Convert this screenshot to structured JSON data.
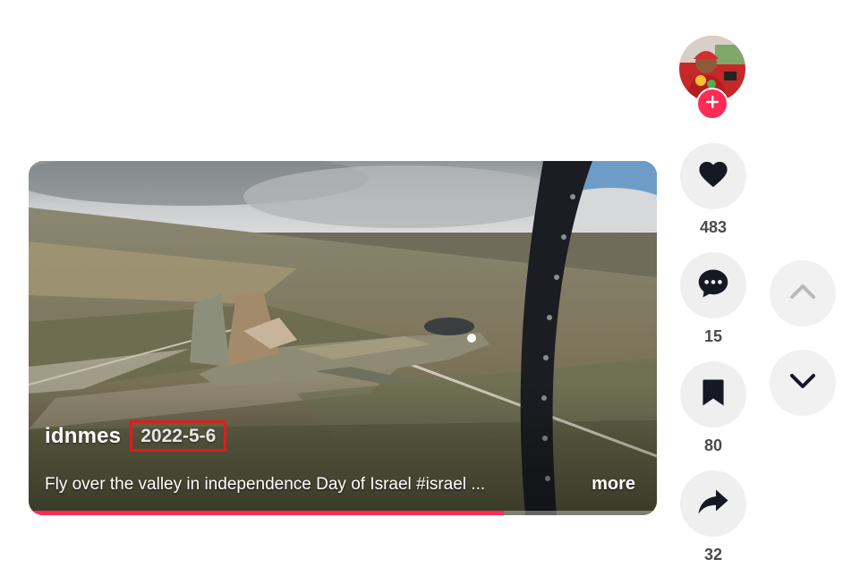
{
  "video": {
    "author": "idnmes",
    "date": "2022-5-6",
    "caption": "Fly over the valley in independence Day of Israel #israel ...",
    "more_label": "more",
    "progress": 0.757
  },
  "actions": {
    "likes": "483",
    "comments": "15",
    "saves": "80",
    "shares": "32"
  },
  "icons": {
    "follow": "plus-icon",
    "like": "heart-icon",
    "comment": "comment-bubble-icon",
    "save": "bookmark-icon",
    "share": "share-arrow-icon",
    "prev": "chevron-up-icon",
    "next": "chevron-down-icon"
  },
  "colors": {
    "accent": "#fe2c55",
    "highlight_box": "#e21b1b",
    "count_text": "#4a4a4a",
    "button_bg": "#efefef"
  }
}
